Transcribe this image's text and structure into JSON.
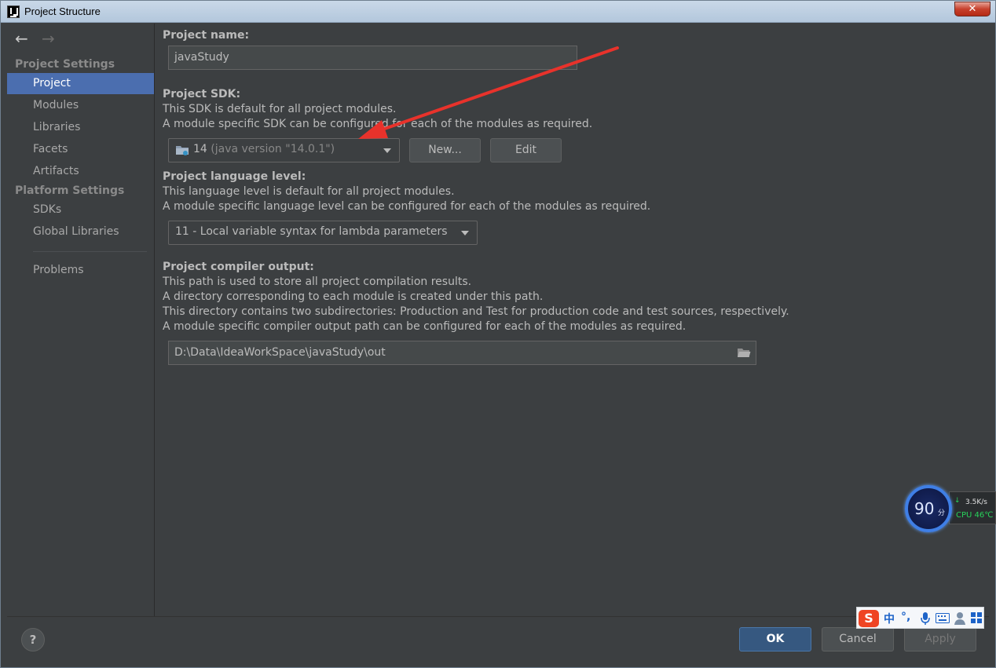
{
  "window": {
    "title": "Project Structure",
    "close_label": "✕"
  },
  "sidebar": {
    "back_glyph": "←",
    "forward_glyph": "→",
    "section_project_settings": "Project Settings",
    "section_platform_settings": "Platform Settings",
    "items": [
      {
        "label": "Project"
      },
      {
        "label": "Modules"
      },
      {
        "label": "Libraries"
      },
      {
        "label": "Facets"
      },
      {
        "label": "Artifacts"
      },
      {
        "label": "SDKs"
      },
      {
        "label": "Global Libraries"
      },
      {
        "label": "Problems"
      }
    ],
    "selected": "Project"
  },
  "project": {
    "name_label": "Project name:",
    "name_value": "javaStudy",
    "sdk_label": "Project SDK:",
    "sdk_desc_1": "This SDK is default for all project modules.",
    "sdk_desc_2": "A module specific SDK can be configured for each of the modules as required.",
    "sdk_version": "14",
    "sdk_version_detail": "(java version \"14.0.1\")",
    "new_button": "New...",
    "edit_button": "Edit",
    "lang_label": "Project language level:",
    "lang_desc_1": "This language level is default for all project modules.",
    "lang_desc_2": "A module specific language level can be configured for each of the modules as required.",
    "lang_value": "11 - Local variable syntax for lambda parameters",
    "output_label": "Project compiler output:",
    "output_desc_1": "This path is used to store all project compilation results.",
    "output_desc_2": "A directory corresponding to each module is created under this path.",
    "output_desc_3": "This directory contains two subdirectories: Production and Test for production code and test sources, respectively.",
    "output_desc_4": "A module specific compiler output path can be configured for each of the modules as required.",
    "output_path": "D:\\Data\\IdeaWorkSpace\\javaStudy\\out"
  },
  "footer": {
    "help_label": "?",
    "ok_label": "OK",
    "cancel_label": "Cancel",
    "apply_label": "Apply"
  },
  "perf_widget": {
    "score": "90",
    "score_unit": "分",
    "net_arrow": "↓",
    "net_speed": "3.5K/s",
    "cpu_temp": "CPU 46℃"
  },
  "ime_toolbar": {
    "logo": "S",
    "lang": "中",
    "punct": "°,",
    "icons": [
      "microphone-icon",
      "keyboard-icon",
      "user-icon",
      "grid-icon"
    ]
  },
  "colors": {
    "background": "#3c3f41",
    "selection": "#4b6eaf",
    "ok_button": "#365880",
    "annotation_arrow": "#e8322b"
  }
}
